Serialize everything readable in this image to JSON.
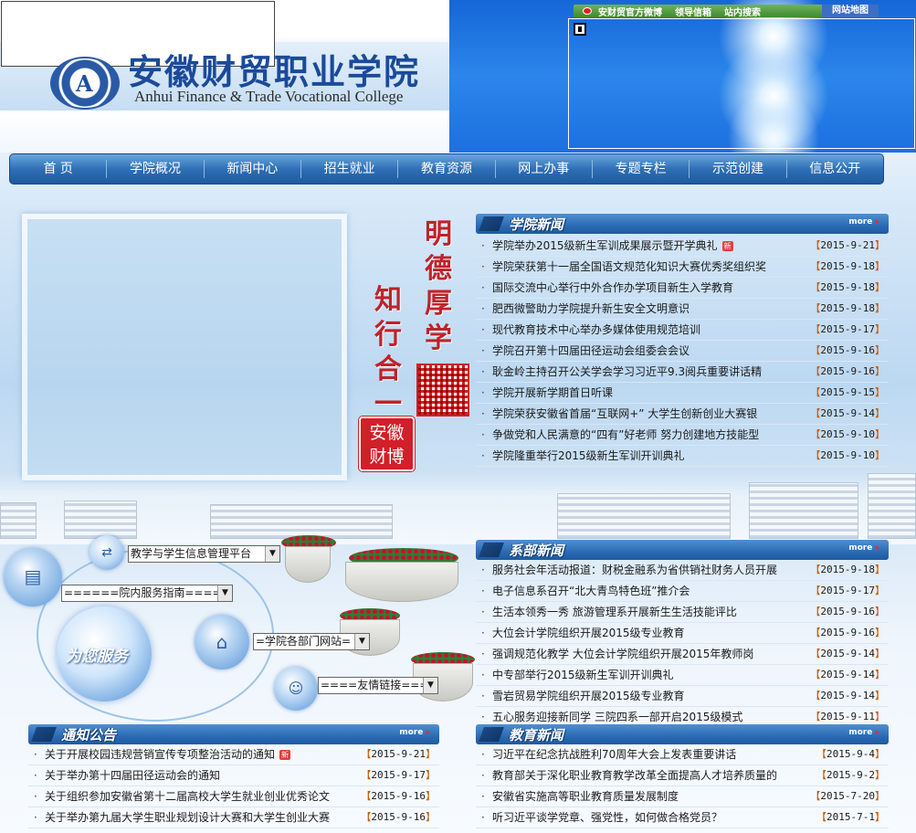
{
  "header": {
    "school_name_cn": "安徽财贸职业学院",
    "school_name_en": "Anhui Finance & Trade Vocational College",
    "seal_mark": "A",
    "top_links": [
      "安财贸官方微博",
      "领导信箱",
      "站内搜索"
    ],
    "sitemap": "网站地图"
  },
  "nav": {
    "items": [
      "首 页",
      "学院概况",
      "新闻中心",
      "招生就业",
      "教育资源",
      "网上办事",
      "专题专栏",
      "示范创建",
      "信息公开"
    ]
  },
  "motto": {
    "line1": [
      "明",
      "德",
      "厚",
      "学"
    ],
    "line2": [
      "知",
      "行",
      "合",
      "一"
    ]
  },
  "weibo_stamp": [
    "安徽",
    "财博"
  ],
  "services": {
    "title": "为您服务",
    "select_1": "教学与学生信息管理平台",
    "select_2": "======院内服务指南======",
    "select_3": "=学院各部门网站=",
    "select_4": "====友情链接===="
  },
  "more_label": "more",
  "college_news": {
    "title": "学院新闻",
    "items": [
      {
        "title": "学院举办2015级新生军训成果展示暨开学典礼",
        "date": "2015-9-21",
        "new": true
      },
      {
        "title": "学院荣获第十一届全国语文规范化知识大赛优秀奖组织奖",
        "date": "2015-9-18",
        "new": false
      },
      {
        "title": "国际交流中心举行中外合作办学项目新生入学教育",
        "date": "2015-9-18",
        "new": false
      },
      {
        "title": "肥西微警助力学院提升新生安全文明意识",
        "date": "2015-9-18",
        "new": false
      },
      {
        "title": "现代教育技术中心举办多媒体使用规范培训",
        "date": "2015-9-17",
        "new": false
      },
      {
        "title": "学院召开第十四届田径运动会组委会会议",
        "date": "2015-9-16",
        "new": false
      },
      {
        "title": "耿金岭主持召开公关学会学习习近平9.3阅兵重要讲话精",
        "date": "2015-9-16",
        "new": false
      },
      {
        "title": "学院开展新学期首日听课",
        "date": "2015-9-15",
        "new": false
      },
      {
        "title": "学院荣获安徽省首届“互联网+” 大学生创新创业大赛银",
        "date": "2015-9-14",
        "new": false
      },
      {
        "title": "争做党和人民满意的“四有”好老师 努力创建地方技能型",
        "date": "2015-9-10",
        "new": false
      },
      {
        "title": "学院隆重举行2015级新生军训开训典礼",
        "date": "2015-9-10",
        "new": false
      }
    ]
  },
  "dept_news": {
    "title": "系部新闻",
    "items": [
      {
        "title": "服务社会年活动报道：财税金融系为省供销社财务人员开展",
        "date": "2015-9-18"
      },
      {
        "title": "电子信息系召开“北大青鸟特色班”推介会",
        "date": "2015-9-17"
      },
      {
        "title": "生活本领秀一秀 旅游管理系开展新生生活技能评比",
        "date": "2015-9-16"
      },
      {
        "title": "大位会计学院组织开展2015级专业教育",
        "date": "2015-9-16"
      },
      {
        "title": "强调规范化教学 大位会计学院组织开展2015年教师岗",
        "date": "2015-9-14"
      },
      {
        "title": "中专部举行2015级新生军训开训典礼",
        "date": "2015-9-14"
      },
      {
        "title": "雪岩贸易学院组织开展2015级专业教育",
        "date": "2015-9-14"
      },
      {
        "title": "五心服务迎接新同学 三院四系一部开启2015级模式",
        "date": "2015-9-11"
      }
    ]
  },
  "notices": {
    "title": "通知公告",
    "items": [
      {
        "title": "关于开展校园违规营销宣传专项整治活动的通知",
        "date": "2015-9-21",
        "new": true
      },
      {
        "title": "关于举办第十四届田径运动会的通知",
        "date": "2015-9-17",
        "new": false
      },
      {
        "title": "关于组织参加安徽省第十二届高校大学生就业创业优秀论文",
        "date": "2015-9-16",
        "new": false
      },
      {
        "title": "关于举办第九届大学生职业规划设计大赛和大学生创业大赛",
        "date": "2015-9-16",
        "new": false
      }
    ]
  },
  "edu_news": {
    "title": "教育新闻",
    "items": [
      {
        "title": "习近平在纪念抗战胜利70周年大会上发表重要讲话",
        "date": "2015-9-4"
      },
      {
        "title": "教育部关于深化职业教育教学改革全面提高人才培养质量的",
        "date": "2015-9-2"
      },
      {
        "title": "安徽省实施高等职业教育质量发展制度",
        "date": "2015-7-20"
      },
      {
        "title": "听习近平谈学党章、强党性，如何做合格党员？",
        "date": "2015-7-1"
      }
    ]
  },
  "new_tag": "新"
}
